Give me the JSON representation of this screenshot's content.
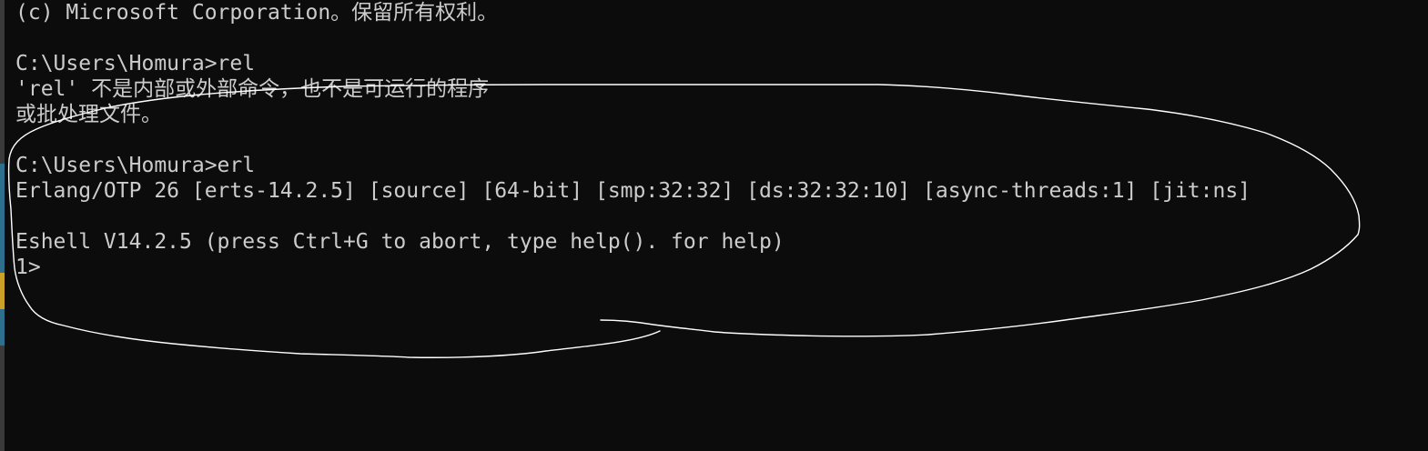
{
  "terminal": {
    "lines": [
      "(c) Microsoft Corporation。保留所有权利。",
      "",
      "C:\\Users\\Homura>rel",
      "'rel' 不是内部或外部命令，也不是可运行的程序",
      "或批处理文件。",
      "",
      "C:\\Users\\Homura>erl",
      "Erlang/OTP 26 [erts-14.2.5] [source] [64-bit] [smp:32:32] [ds:32:32:10] [async-threads:1] [jit:ns]",
      "",
      "Eshell V14.2.5 (press Ctrl+G to abort, type help(). for help)",
      "1>"
    ]
  },
  "colors": {
    "background": "#0c0c0c",
    "text": "#cccccc",
    "annotation_stroke": "#ffffff"
  }
}
